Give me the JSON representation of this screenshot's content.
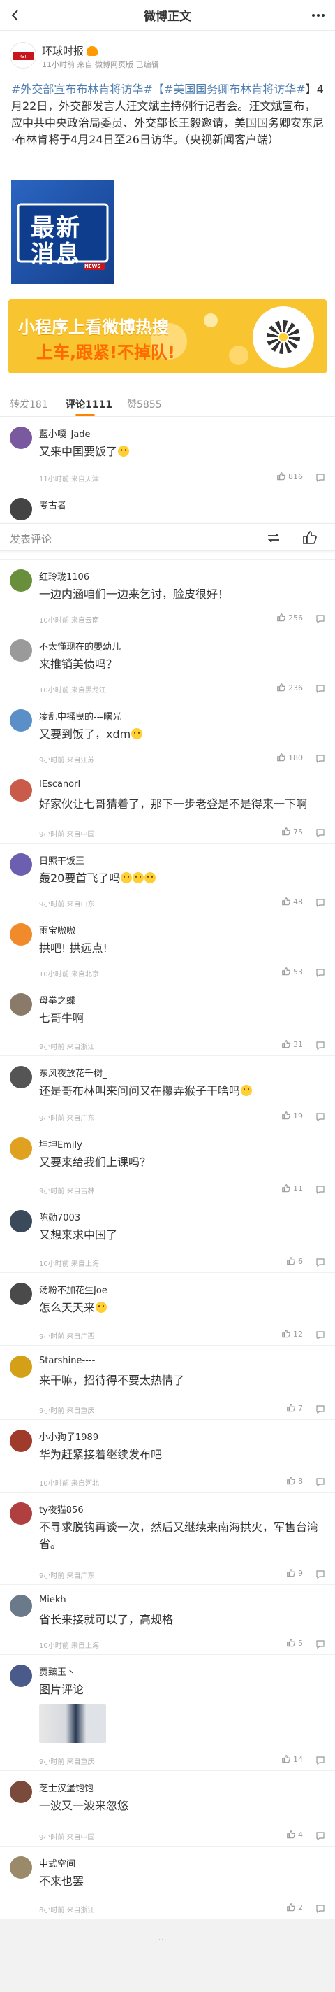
{
  "nav": {
    "title": "微博正文"
  },
  "author": {
    "name": "环球时报",
    "meta": "11小时前 来自 微博网页版 已编辑",
    "logo_text": "环球时报"
  },
  "post": {
    "tag1": "#外交部宣布布林肯将访华#",
    "tag2": "【#美国国务卿布林肯将访华#",
    "text": "】4月22日，外交部发言人汪文斌主持例行记者会。汪文斌宣布，应中共中央政治局委员、外交部长王毅邀请，美国国务卿安东尼·布林肯将于4月24日至26日访华。（央视新闻客户端）"
  },
  "image": {
    "line1": "最新",
    "line2": "消息",
    "badge": "NEWS"
  },
  "banner": {
    "line1": "小程序上看微博热搜",
    "line2": "上车,跟紧!不掉队!",
    "colors": {
      "bg": "#f7c72e",
      "accent": "#ff7a00"
    }
  },
  "tabs": [
    {
      "label": "转发181"
    },
    {
      "label": "评论1111"
    },
    {
      "label": "赞5855"
    }
  ],
  "composer": {
    "placeholder": "发表评论"
  },
  "comments": [
    {
      "name": "藍小嘎_Jade",
      "text": "又来中国要饭了",
      "time": "11小时前 来自天津",
      "likes": "816",
      "color": "#7a5a9e"
    },
    {
      "name": "考古者",
      "text": "",
      "time": "",
      "likes": "",
      "color": "#444444"
    },
    {
      "name": "红玲珑1106",
      "text": "一边内涵咱们一边来乞讨，脸皮很好！",
      "time": "10小时前 来自云南",
      "likes": "256",
      "color": "#6a8f3c"
    },
    {
      "name": "不太懂现在的嬰幼儿",
      "text": "来推销美债吗？",
      "time": "10小时前 来自黑龙江",
      "likes": "236",
      "color": "#9a9a9a"
    },
    {
      "name": "凌乱中摇曳的---曙光",
      "text": "又要到饭了，xdm",
      "time": "9小时前 来自江苏",
      "likes": "180",
      "color": "#5b8fc7"
    },
    {
      "name": "IEscanorI",
      "text": "好家伙让七哥猜着了，那下一步老登是不是得来一下啊",
      "time": "9小时前 来自中国",
      "likes": "75",
      "color": "#c95b4a"
    },
    {
      "name": "日照干饭王",
      "text": "轰20要首飞了吗",
      "time": "9小时前 来自山东",
      "likes": "48",
      "color": "#6d5fb0"
    },
    {
      "name": "雨宝嗷嗷",
      "text": "拱吧! 拱远点!",
      "time": "10小时前 来自北京",
      "likes": "53",
      "color": "#f08a2a"
    },
    {
      "name": "母拳之蝶",
      "text": "七哥牛啊",
      "time": "9小时前 来自浙江",
      "likes": "31",
      "color": "#8a7a6a"
    },
    {
      "name": "东风夜放花千树_",
      "text": "还是哥布林叫来问问又在攥弄猴子干啥吗",
      "time": "9小时前 来自广东",
      "likes": "19",
      "color": "#555555"
    },
    {
      "name": "坤坤Emily",
      "text": "又要来给我们上课吗？",
      "time": "9小时前 来自吉林",
      "likes": "11",
      "color": "#e0a020"
    },
    {
      "name": "陈勋7003",
      "text": "又想来求中国了",
      "time": "10小时前 来自上海",
      "likes": "6",
      "color": "#3a4a5a"
    },
    {
      "name": "汤粉不加花生Joe",
      "text": "怎么天天来",
      "time": "9小时前 来自广西",
      "likes": "12",
      "color": "#4a4a4a"
    },
    {
      "name": "Starshine----",
      "text": "来干嘛，招待得不要太热情了",
      "time": "9小时前 来自重庆",
      "likes": "7",
      "color": "#d4a017"
    },
    {
      "name": "小小狗子1989",
      "text": "华为赶紧接着继续发布吧",
      "time": "10小时前 来自河北",
      "likes": "8",
      "color": "#a03a2a"
    },
    {
      "name": "ty夜猫856",
      "text": "不寻求脱钩再谈一次，然后又继续来南海拱火，军售台湾省。",
      "time": "9小时前 来自广东",
      "likes": "9",
      "color": "#b04040"
    },
    {
      "name": "Miekh",
      "text": "省长来接就可以了，高规格",
      "time": "10小时前 来自上海",
      "likes": "5",
      "color": "#6a7a8a"
    },
    {
      "name": "贾臻玉丶",
      "text": "图片评论",
      "time": "9小时前 来自重庆",
      "likes": "14",
      "color": "#4a5a8a"
    },
    {
      "name": "芝士汉堡饱饱",
      "text": "一波又一波来忽悠",
      "time": "9小时前 来自中国",
      "likes": "4",
      "color": "#7a4a3a"
    },
    {
      "name": "中式空间",
      "text": "不来也罢",
      "time": "8小时前 来自浙江",
      "likes": "2",
      "color": "#9a8a6a"
    }
  ],
  "footer": {
    "loading": "˙ⵗ˙"
  }
}
